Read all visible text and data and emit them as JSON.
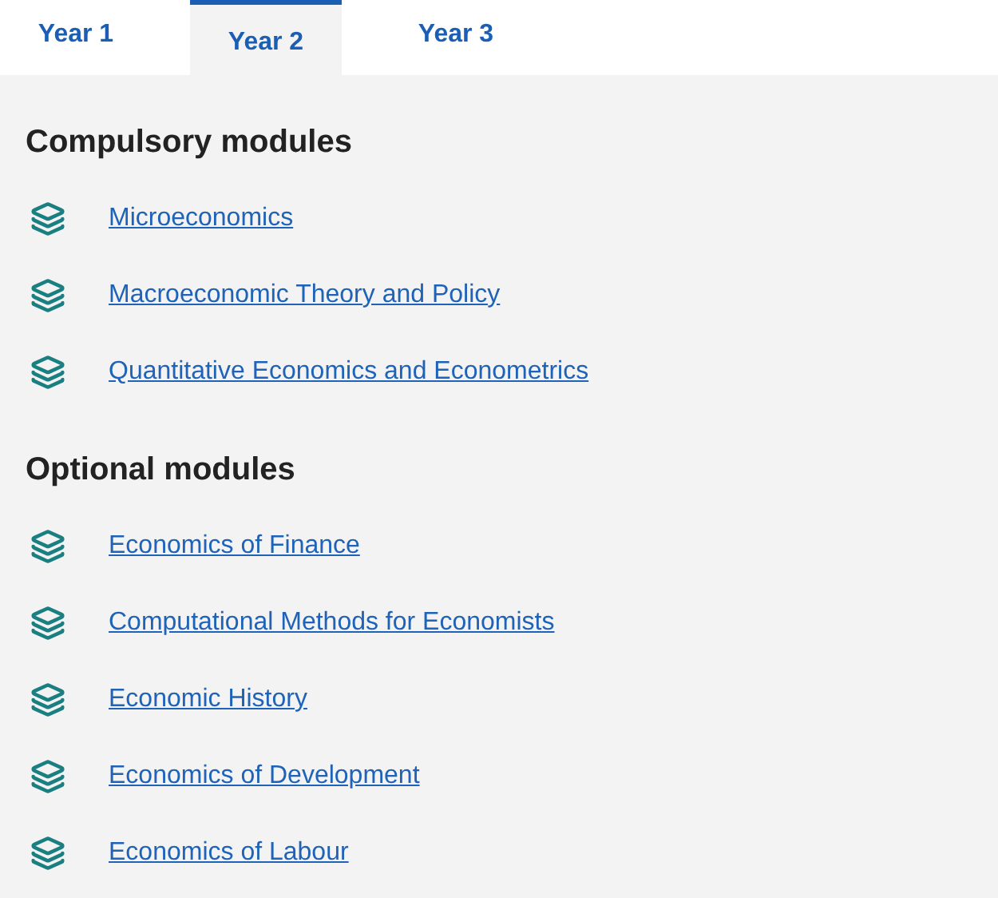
{
  "tabs": [
    {
      "label": "Year 1",
      "selected": false
    },
    {
      "label": "Year 2",
      "selected": true
    },
    {
      "label": "Year 3",
      "selected": false
    }
  ],
  "sections": [
    {
      "heading": "Compulsory modules",
      "modules": [
        "Microeconomics",
        "Macroeconomic Theory and Policy",
        "Quantitative Economics and Econometrics"
      ]
    },
    {
      "heading": "Optional modules",
      "modules": [
        "Economics of Finance",
        "Computational Methods for Economists",
        "Economic History",
        "Economics of Development",
        "Economics of Labour"
      ]
    }
  ]
}
